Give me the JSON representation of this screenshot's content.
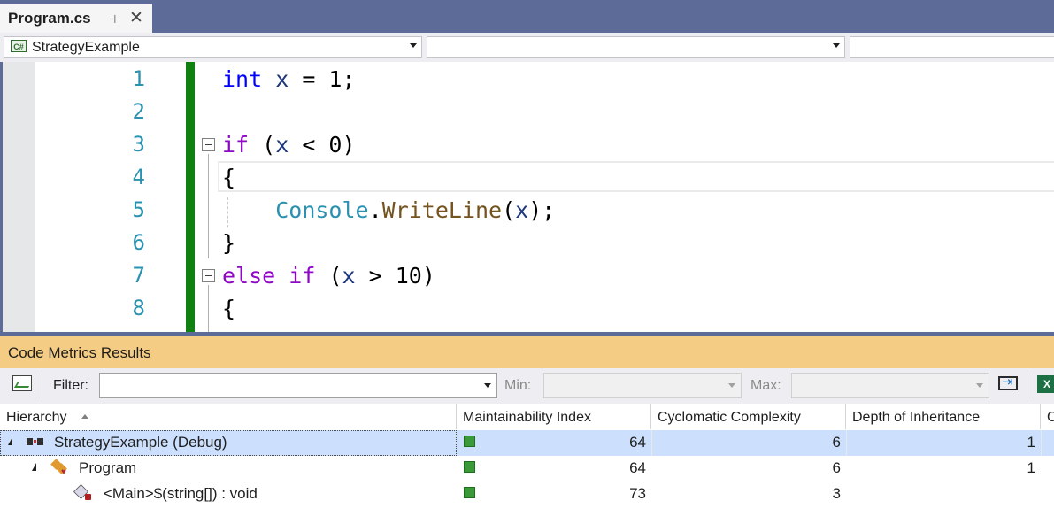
{
  "document_tab": {
    "title": "Program.cs",
    "pin_glyph": "⊣",
    "close_glyph": "✕"
  },
  "navigation_bar": {
    "project_dropdown": {
      "language_badge": "C#",
      "value": "StrategyExample"
    },
    "type_dropdown": {
      "value": ""
    },
    "member_dropdown": {
      "value": ""
    }
  },
  "editor": {
    "line_numbers": [
      "1",
      "2",
      "3",
      "4",
      "5",
      "6",
      "7",
      "8"
    ],
    "lines": [
      {
        "tokens": [
          {
            "t": "int",
            "c": "kw"
          },
          {
            "t": " "
          },
          {
            "t": "x",
            "c": "var"
          },
          {
            "t": " = 1;"
          }
        ]
      },
      {
        "tokens": []
      },
      {
        "tokens": [
          {
            "t": "if",
            "c": "kw2"
          },
          {
            "t": " ("
          },
          {
            "t": "x",
            "c": "var"
          },
          {
            "t": " < 0)"
          }
        ],
        "collapsible": true
      },
      {
        "tokens": [
          {
            "t": "{"
          }
        ]
      },
      {
        "tokens": [
          {
            "t": "    "
          },
          {
            "t": "Console",
            "c": "cls"
          },
          {
            "t": "."
          },
          {
            "t": "WriteLine",
            "c": "mth"
          },
          {
            "t": "("
          },
          {
            "t": "x",
            "c": "var"
          },
          {
            "t": ");"
          }
        ]
      },
      {
        "tokens": [
          {
            "t": "}"
          }
        ]
      },
      {
        "tokens": [
          {
            "t": "else",
            "c": "kw2"
          },
          {
            "t": " "
          },
          {
            "t": "if",
            "c": "kw2"
          },
          {
            "t": " ("
          },
          {
            "t": "x",
            "c": "var"
          },
          {
            "t": " > 10)"
          }
        ],
        "collapsible": true
      },
      {
        "tokens": [
          {
            "t": "{"
          }
        ]
      }
    ]
  },
  "code_metrics": {
    "title": "Code Metrics Results",
    "toolbar": {
      "filter_label": "Filter:",
      "filter_value": "",
      "min_label": "Min:",
      "min_value": "",
      "max_label": "Max:",
      "max_value": "",
      "excel_glyph": "X"
    },
    "columns": [
      "Hierarchy",
      "Maintainability Index",
      "Cyclomatic Complexity",
      "Depth of Inheritance",
      "C"
    ],
    "rows": [
      {
        "name": "StrategyExample (Debug)",
        "icon": "assembly-icon",
        "mi": "64",
        "cc": "6",
        "doi": "1",
        "selected": true
      },
      {
        "name": "Program",
        "icon": "class-icon",
        "mi": "64",
        "cc": "6",
        "doi": "1",
        "selected": false
      },
      {
        "name": "<Main>$(string[]) : void",
        "icon": "private-method-icon",
        "mi": "73",
        "cc": "3",
        "doi": "",
        "selected": false
      }
    ]
  },
  "colors": {
    "tab_strip": "#5d6b99",
    "tool_window_title": "#f5cc84",
    "change_bar": "#108010",
    "selected_row": "#cce0fd",
    "maintainability_good": "#3a9a3a"
  }
}
